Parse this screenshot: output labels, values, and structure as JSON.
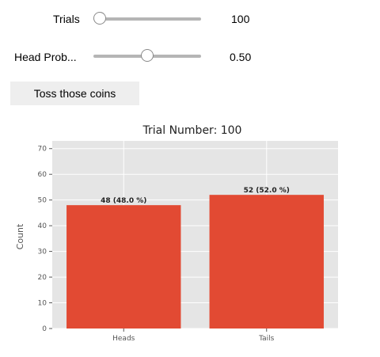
{
  "controls": {
    "trials": {
      "label": "Trials",
      "value": 100,
      "display": "100",
      "fraction": 0.0
    },
    "head_prob": {
      "label": "Head Prob...",
      "value": 0.5,
      "display": "0.50",
      "fraction": 0.5
    },
    "toss_button_label": "Toss those coins"
  },
  "colors": {
    "bar": "#e24a33",
    "plot_bg": "#e5e5e5",
    "grid": "#ffffff"
  },
  "chart_data": {
    "type": "bar",
    "title": "Trial Number:  100",
    "ylabel": "Count",
    "xlabel": "",
    "categories": [
      "Heads",
      "Tails"
    ],
    "values": [
      48,
      52
    ],
    "data_labels": [
      "48 (48.0 %)",
      "52 (52.0 %)"
    ],
    "ylim": [
      0,
      73
    ],
    "yticks": [
      0,
      10,
      20,
      30,
      40,
      50,
      60,
      70
    ],
    "grid": true
  }
}
